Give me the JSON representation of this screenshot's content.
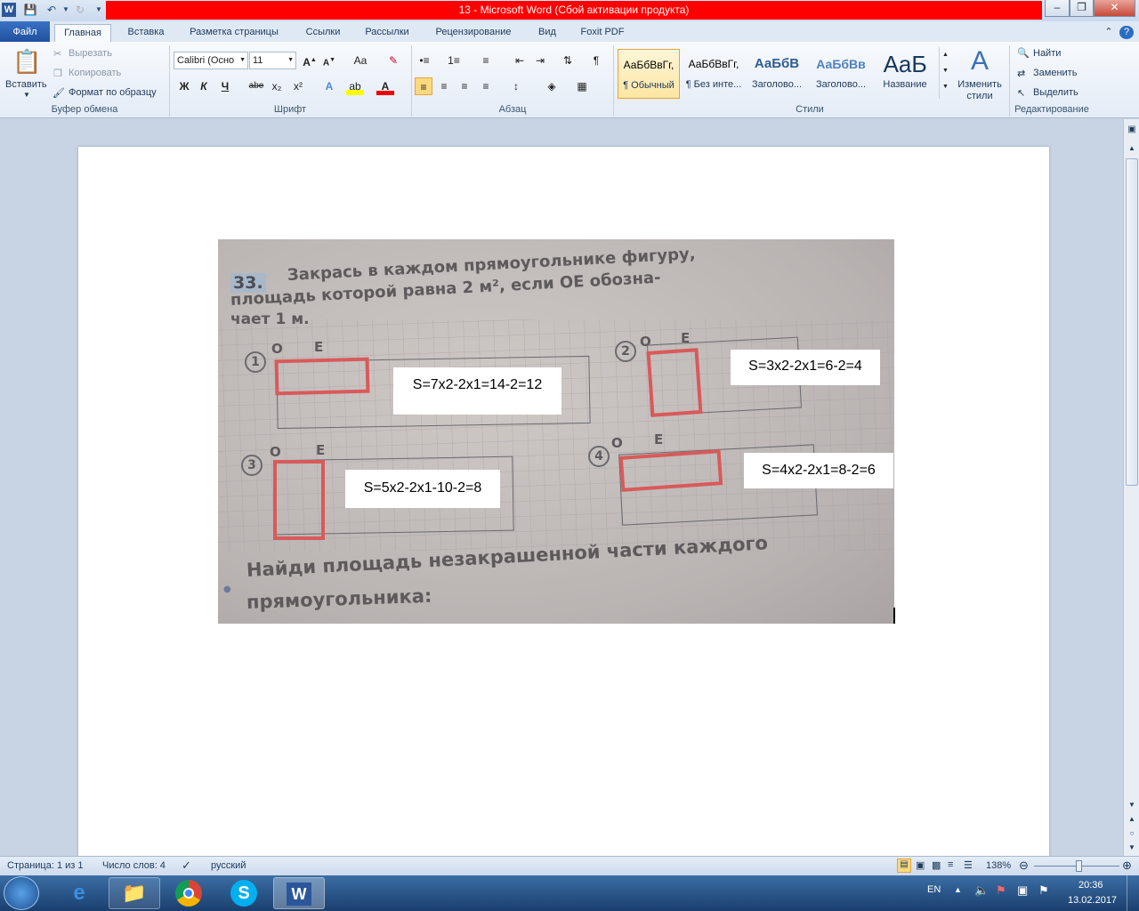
{
  "window": {
    "title": "13  -  Microsoft Word (Сбой активации продукта)"
  },
  "tabs": {
    "file": "Файл",
    "home": "Главная",
    "insert": "Вставка",
    "layout": "Разметка страницы",
    "refs": "Ссылки",
    "mailings": "Рассылки",
    "review": "Рецензирование",
    "view": "Вид",
    "foxit": "Foxit PDF"
  },
  "clipboard": {
    "paste": "Вставить",
    "cut": "Вырезать",
    "copy": "Копировать",
    "format_painter": "Формат по образцу",
    "label": "Буфер обмена"
  },
  "font": {
    "name": "Calibri (Осно",
    "size": "11",
    "label": "Шрифт",
    "bold": "Ж",
    "italic": "К",
    "underline": "Ч",
    "strike": "abe",
    "case": "Aa"
  },
  "paragraph": {
    "label": "Абзац"
  },
  "styles": {
    "label": "Стили",
    "items": [
      {
        "preview": "АаБбВвГг,",
        "name": "¶ Обычный"
      },
      {
        "preview": "АаБбВвГг,",
        "name": "¶ Без инте..."
      },
      {
        "preview": "АаБбВ",
        "name": "Заголово..."
      },
      {
        "preview": "АаБбВв",
        "name": "Заголово..."
      },
      {
        "preview": "AaƂ",
        "name": "Название"
      }
    ],
    "change": "Изменить стили"
  },
  "editing": {
    "label": "Редактирование",
    "find": "Найти",
    "replace": "Заменить",
    "select": "Выделить"
  },
  "photo": {
    "task_number": "33.",
    "line1": "Закрась  в  каждом  прямоугольнике  фигуру,",
    "line2": "площадь  которой  равна  2 м², если  OE  обозна-",
    "line3": "чает  1 м.",
    "bottom1": "Найди  площадь  незакрашенной  части  каждого",
    "bottom2": "прямоугольника:",
    "nums": [
      "1",
      "2",
      "3",
      "4"
    ],
    "o": "O",
    "e": "E"
  },
  "answers": [
    "S=7x2-2x1=14-2=12",
    "S=3x2-2x1=6-2=4",
    "S=5x2-2x1-10-2=8",
    "S=4x2-2x1=8-2=6"
  ],
  "status": {
    "page": "Страница: 1 из 1",
    "words": "Число слов: 4",
    "lang": "русский",
    "zoom": "138%"
  },
  "tray": {
    "lang": "EN",
    "time": "20:36",
    "date": "13.02.2017"
  }
}
